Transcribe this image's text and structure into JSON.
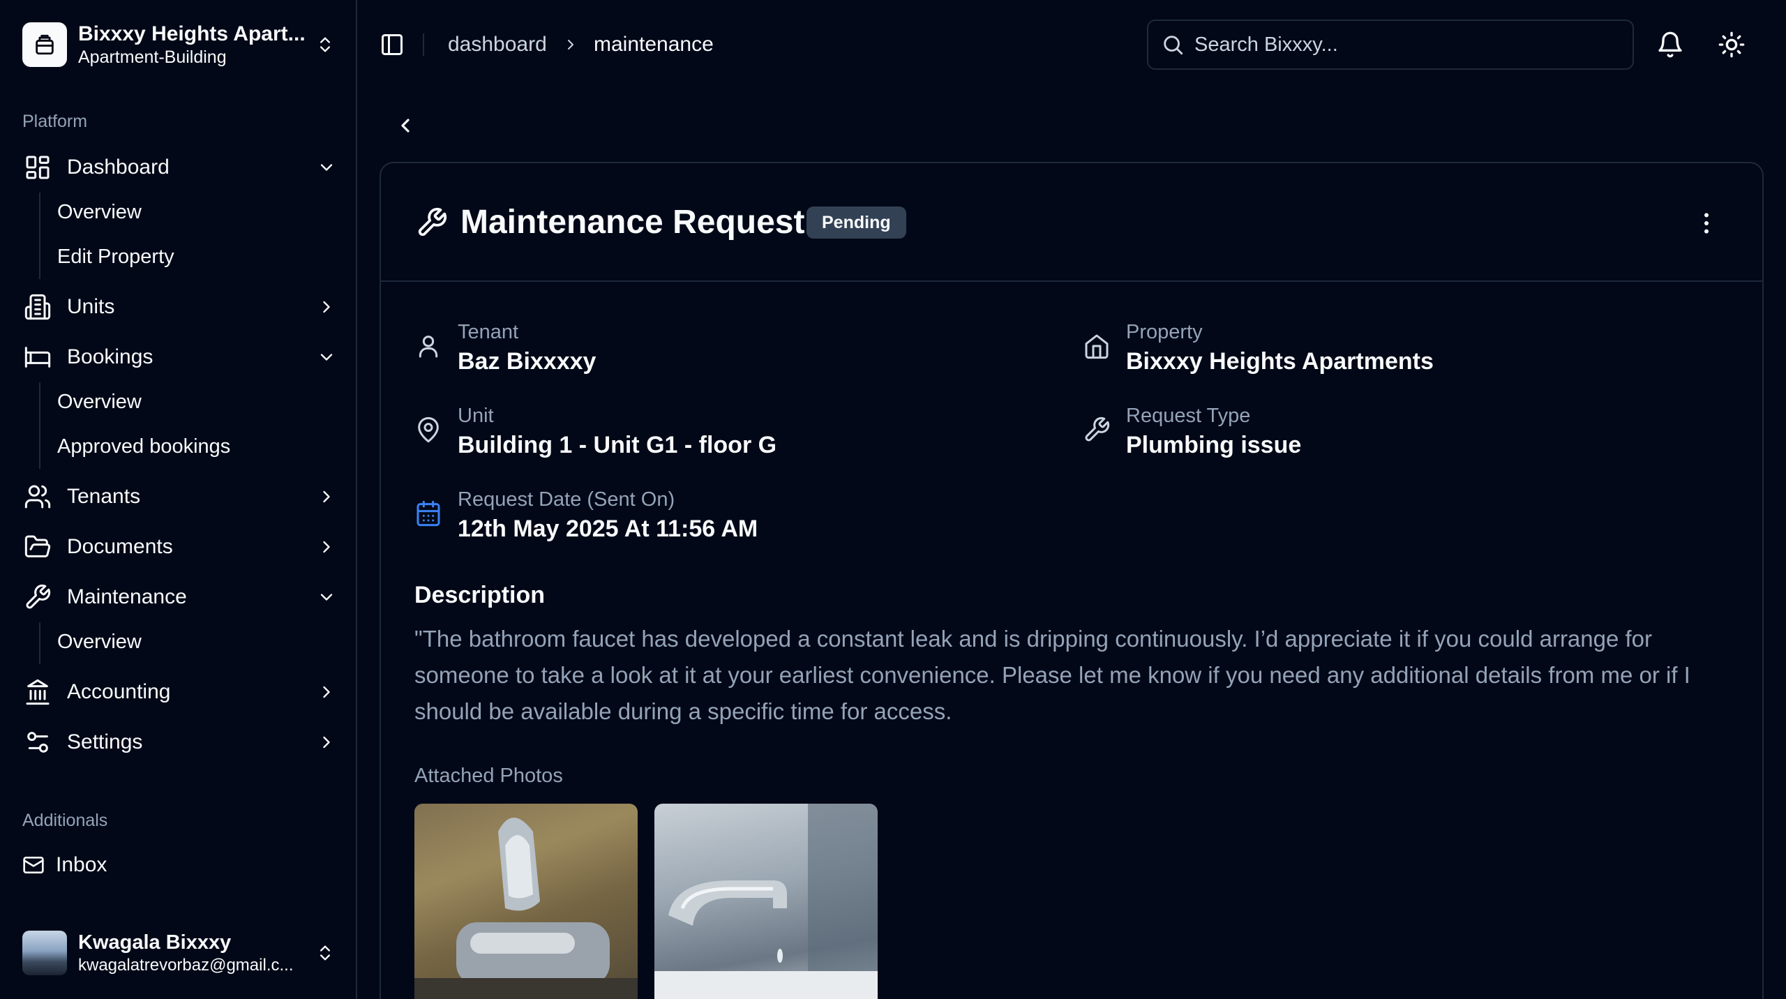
{
  "org": {
    "name": "Bixxxy Heights Apart...",
    "type": "Apartment-Building"
  },
  "nav": {
    "platform_label": "Platform",
    "dashboard": {
      "label": "Dashboard",
      "sub": [
        "Overview",
        "Edit Property"
      ]
    },
    "units": {
      "label": "Units"
    },
    "bookings": {
      "label": "Bookings",
      "sub": [
        "Overview",
        "Approved bookings"
      ]
    },
    "tenants": {
      "label": "Tenants"
    },
    "documents": {
      "label": "Documents"
    },
    "maintenance": {
      "label": "Maintenance",
      "sub": [
        "Overview"
      ]
    },
    "accounting": {
      "label": "Accounting"
    },
    "settings": {
      "label": "Settings"
    },
    "additionals_label": "Additionals",
    "inbox": {
      "label": "Inbox"
    }
  },
  "user": {
    "name": "Kwagala Bixxxy",
    "email": "kwagalatrevorbaz@gmail.c..."
  },
  "breadcrumb": [
    "dashboard",
    "maintenance"
  ],
  "search": {
    "placeholder": "Search Bixxxy..."
  },
  "request": {
    "title": "Maintenance Request",
    "status": "Pending",
    "fields": {
      "tenant": {
        "label": "Tenant",
        "value": "Baz Bixxxxy"
      },
      "property": {
        "label": "Property",
        "value": "Bixxxy Heights Apartments"
      },
      "unit": {
        "label": "Unit",
        "value": "Building 1 - Unit G1 - floor G"
      },
      "request_type": {
        "label": "Request Type",
        "value": "Plumbing issue"
      },
      "request_date": {
        "label": "Request Date (Sent On)",
        "value": "12th May 2025 At 11:56 AM"
      }
    },
    "description_title": "Description",
    "description": "\"The bathroom faucet has developed a constant leak and is dripping continuously. I’d appreciate it if you could arrange for someone to take a look at it at your earliest convenience. Please let me know if you need any additional details from me or if I should be available during a specific time for access.",
    "photos_label": "Attached Photos"
  },
  "colors": {
    "background": "#020817",
    "border": "#1e293b",
    "muted_text": "#94a3b8",
    "badge_bg": "#334155",
    "calendar_accent": "#3b82f6"
  }
}
